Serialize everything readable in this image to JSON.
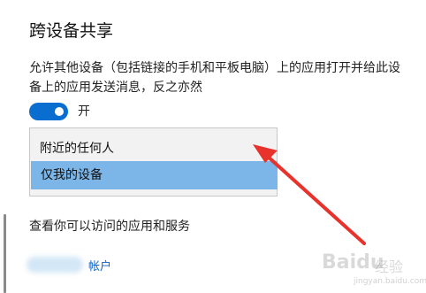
{
  "section": {
    "title": "跨设备共享",
    "description": "允许其他设备（包括链接的手机和平板电脑）上的应用打开并给此设备上的应用发送消息，反之亦然"
  },
  "toggle": {
    "state": "on",
    "label": "开",
    "color": "#0a6ed1"
  },
  "dropdown": {
    "options": [
      "附近的任何人",
      "仅我的设备"
    ],
    "selected": "仅我的设备",
    "highlight_color": "#7cb5e8"
  },
  "links": {
    "apps_services": "查看你可以访问的应用和服务",
    "account": "帐户"
  },
  "annotation": {
    "arrow_color": "#e8322c"
  },
  "watermark": {
    "brand": "Baidu",
    "product": "经验",
    "url": "jingyan.baidu.com"
  }
}
